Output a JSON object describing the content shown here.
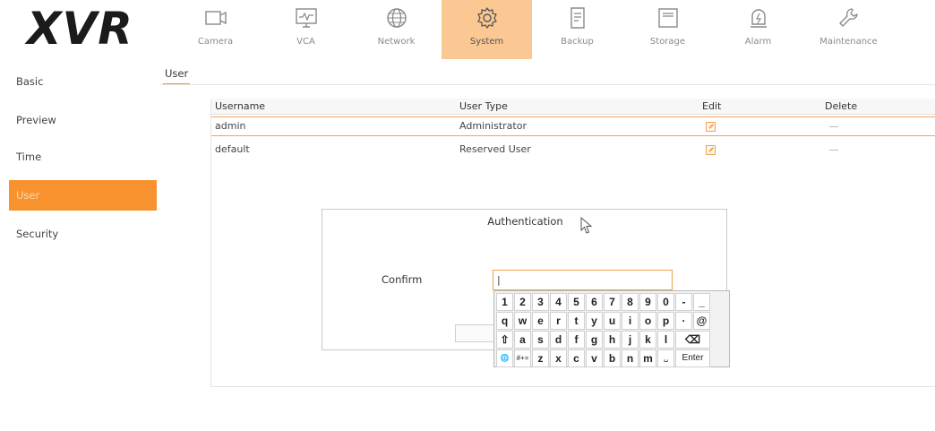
{
  "app": {
    "logo": "XVR"
  },
  "nav": [
    {
      "id": "camera",
      "label": "Camera",
      "icon": "camera-icon"
    },
    {
      "id": "vca",
      "label": "VCA",
      "icon": "vca-monitor-icon"
    },
    {
      "id": "network",
      "label": "Network",
      "icon": "globe-icon"
    },
    {
      "id": "system",
      "label": "System",
      "icon": "gear-icon",
      "active": true
    },
    {
      "id": "backup",
      "label": "Backup",
      "icon": "document-icon"
    },
    {
      "id": "storage",
      "label": "Storage",
      "icon": "storage-icon"
    },
    {
      "id": "alarm",
      "label": "Alarm",
      "icon": "alarm-icon"
    },
    {
      "id": "maintenance",
      "label": "Maintenance",
      "icon": "wrench-icon"
    }
  ],
  "sidebar": {
    "items": [
      {
        "label": "Basic"
      },
      {
        "label": "Preview"
      },
      {
        "label": "Time"
      },
      {
        "label": "User",
        "active": true
      },
      {
        "label": "Security"
      }
    ]
  },
  "subtab": {
    "label": "User"
  },
  "table": {
    "columns": [
      "Username",
      "User Type",
      "Edit",
      "Delete"
    ],
    "rows": [
      {
        "username": "admin",
        "user_type": "Administrator",
        "selected": true
      },
      {
        "username": "default",
        "user_type": "Reserved User",
        "selected": false
      }
    ]
  },
  "dialog": {
    "title": "Authentication",
    "confirm_label": "Confirm",
    "confirm_value": "|"
  },
  "keyboard": {
    "row1": [
      "1",
      "2",
      "3",
      "4",
      "5",
      "6",
      "7",
      "8",
      "9",
      "0",
      "-",
      "_"
    ],
    "row2": [
      "q",
      "w",
      "e",
      "r",
      "t",
      "y",
      "u",
      "i",
      "o",
      "p",
      "·",
      "@"
    ],
    "row3": [
      "⇧",
      "a",
      "s",
      "d",
      "f",
      "g",
      "h",
      "j",
      "k",
      "l"
    ],
    "row3_backspace": "⌫",
    "row4": [
      "🌐",
      "#+=",
      "z",
      "x",
      "c",
      "v",
      "b",
      "n",
      "m",
      "␣"
    ],
    "enter_label": "Enter"
  },
  "colors": {
    "accent": "#f7922f",
    "active_tab": "#fbc792"
  }
}
